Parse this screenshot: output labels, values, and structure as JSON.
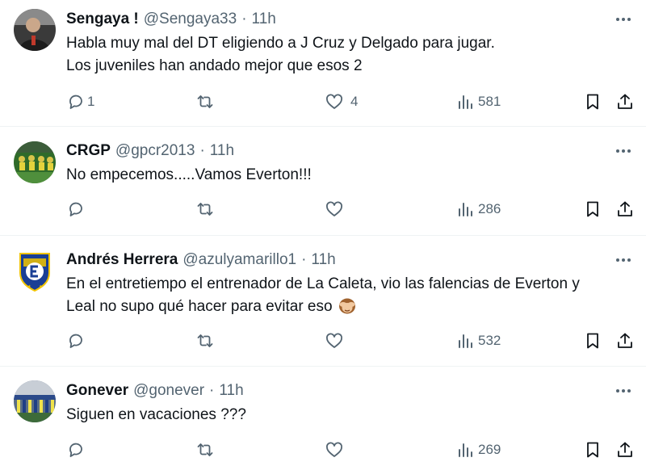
{
  "colors": {
    "text": "#0f1419",
    "muted": "#536471",
    "divider": "#eff3f4"
  },
  "icons": [
    "more-icon",
    "reply-icon",
    "retweet-icon",
    "like-icon",
    "views-icon",
    "bookmark-icon",
    "share-icon",
    "see-no-evil-monkey-emoji"
  ],
  "tweets": [
    {
      "name": "Sengaya !",
      "handle": "@Sengaya33",
      "sep": "·",
      "time": "11h",
      "lines": [
        "Habla muy mal del DT eligiendo a J Cruz y Delgado para jugar.",
        "Los juveniles han andado mejor que esos 2"
      ],
      "replies": "1",
      "retweets": "",
      "likes": "4",
      "views": "581"
    },
    {
      "name": "CRGP",
      "handle": "@gpcr2013",
      "sep": "·",
      "time": "11h",
      "lines": [
        "No empecemos.....Vamos Everton!!!"
      ],
      "replies": "",
      "retweets": "",
      "likes": "",
      "views": "286"
    },
    {
      "name": "Andrés Herrera",
      "handle": "@azulyamarillo1",
      "sep": "·",
      "time": "11h",
      "lines": [
        "En el entretiempo el entrenador de La Caleta, vio las falencias de Everton y",
        "Leal no supo qué hacer para evitar eso"
      ],
      "replies": "",
      "retweets": "",
      "likes": "",
      "views": "532"
    },
    {
      "name": "Gonever",
      "handle": "@gonever",
      "sep": "·",
      "time": "11h",
      "lines": [
        "Siguen en vacaciones ???"
      ],
      "replies": "",
      "retweets": "",
      "likes": "",
      "views": "269"
    }
  ]
}
